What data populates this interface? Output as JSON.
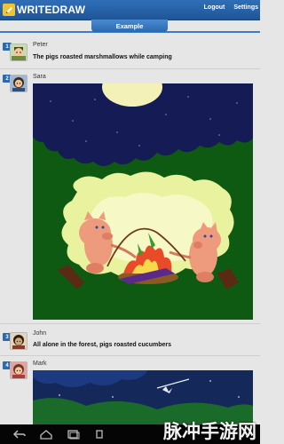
{
  "app": {
    "logo_text": "WRITEDRAW",
    "logout_label": "Logout",
    "settings_label": "Settings",
    "tab_label": "Example"
  },
  "entries": [
    {
      "number": "1",
      "name": "Peter",
      "text": "The pigs roasted marshmallows while camping"
    },
    {
      "number": "2",
      "name": "Sara"
    },
    {
      "number": "3",
      "name": "John",
      "text": "All alone in the forest, pigs roasted cucumbers"
    },
    {
      "number": "4",
      "name": "Mark"
    }
  ],
  "watermark": "脉冲手游网"
}
